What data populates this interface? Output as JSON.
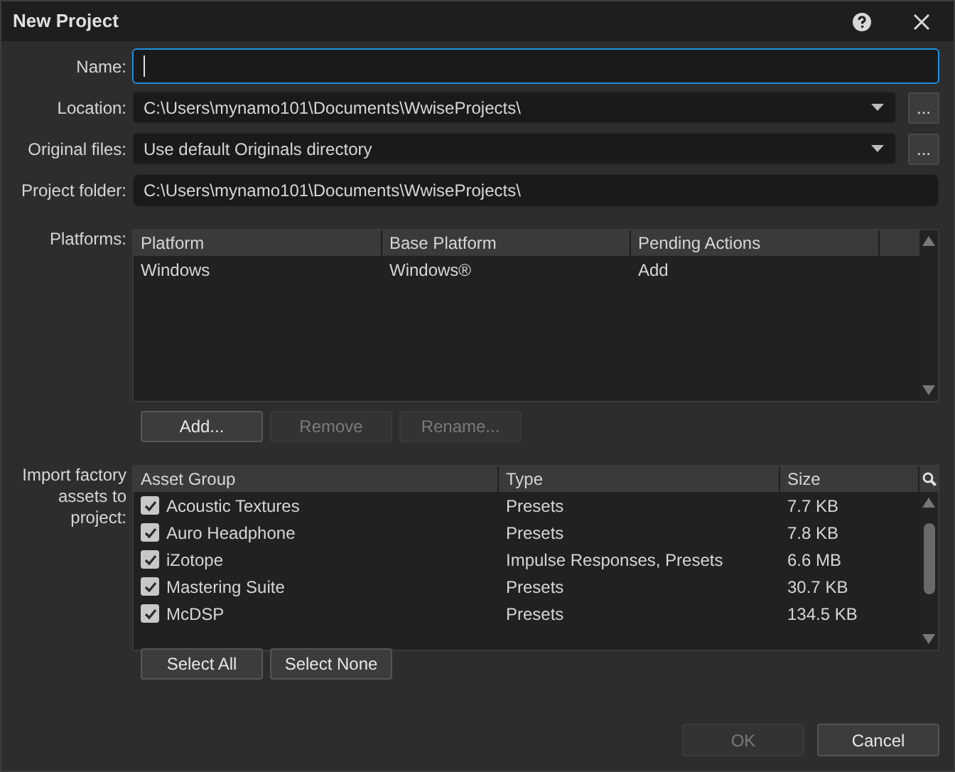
{
  "window": {
    "title": "New Project"
  },
  "fields": [
    {
      "label": "Name:",
      "kind": "text",
      "focused": true
    },
    {
      "label": "Location:",
      "kind": "combo",
      "value": "C:\\Users\\mynamo101\\Documents\\WwiseProjects\\",
      "browse": "..."
    },
    {
      "label": "Original files:",
      "kind": "combo",
      "value": "Use default Originals directory",
      "browse": "..."
    },
    {
      "label": "Project folder:",
      "kind": "readonly",
      "value": "C:\\Users\\mynamo101\\Documents\\WwiseProjects\\"
    }
  ],
  "platforms": {
    "label": "Platforms:",
    "columns": [
      "Platform",
      "Base Platform",
      "Pending Actions"
    ],
    "rows": [
      {
        "cells": [
          "Windows",
          "Windows®",
          "Add"
        ]
      }
    ],
    "buttons": [
      {
        "label": "Add...",
        "disabled": false
      },
      {
        "label": "Remove",
        "disabled": true
      },
      {
        "label": "Rename...",
        "disabled": true
      }
    ]
  },
  "assets": {
    "label": "Import factory assets to project:",
    "columns": [
      "Asset Group",
      "Type",
      "Size"
    ],
    "rows": [
      {
        "checked": true,
        "cells": [
          "Acoustic Textures",
          "Presets",
          "7.7 KB"
        ]
      },
      {
        "checked": true,
        "cells": [
          "Auro Headphone",
          "Presets",
          "7.8 KB"
        ]
      },
      {
        "checked": true,
        "cells": [
          "iZotope",
          "Impulse Responses, Presets",
          "6.6 MB"
        ]
      },
      {
        "checked": true,
        "cells": [
          "Mastering Suite",
          "Presets",
          "30.7 KB"
        ]
      },
      {
        "checked": true,
        "cells": [
          "McDSP",
          "Presets",
          "134.5 KB"
        ]
      }
    ],
    "buttons": [
      {
        "label": "Select All",
        "disabled": false
      },
      {
        "label": "Select None",
        "disabled": false
      }
    ]
  },
  "footer": [
    {
      "label": "OK",
      "disabled": true
    },
    {
      "label": "Cancel",
      "disabled": false
    }
  ]
}
